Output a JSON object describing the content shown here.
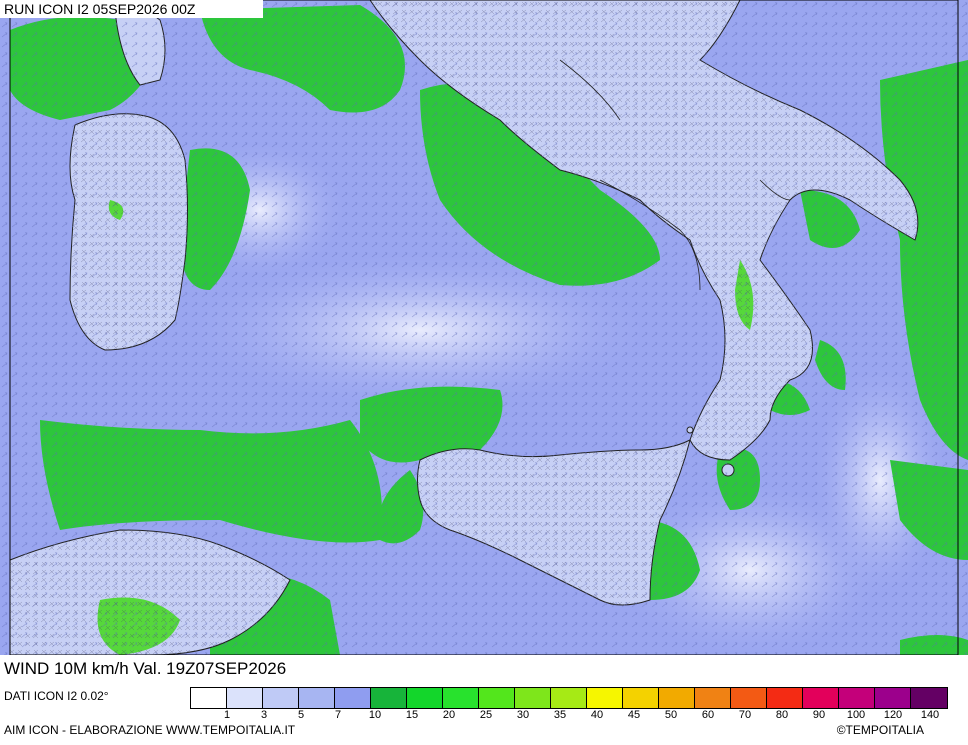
{
  "header": {
    "run": "RUN ICON I2 05SEP2026 00Z"
  },
  "panel": {
    "title": "WIND 10M km/h Val. 19Z07SEP2026"
  },
  "info": {
    "data_source": "DATI ICON I2 0.02°"
  },
  "footer": {
    "left": "AIM ICON - ELABORAZIONE WWW.TEMPOITALIA.IT",
    "right": "©TEMPOITALIA"
  },
  "legend": {
    "ticks": [
      "1",
      "3",
      "5",
      "7",
      "10",
      "15",
      "20",
      "25",
      "30",
      "35",
      "40",
      "45",
      "50",
      "60",
      "70",
      "80",
      "90",
      "100",
      "120",
      "140"
    ],
    "colors": [
      "#ffffff",
      "#dbe2fb",
      "#bfcaf6",
      "#a7b5f2",
      "#8f9df0",
      "#17b43a",
      "#13d62b",
      "#28e22d",
      "#53e61c",
      "#7ee61b",
      "#a6ea15",
      "#f6f600",
      "#f4d200",
      "#f2aa00",
      "#f08214",
      "#f35a14",
      "#f42b14",
      "#e3005b",
      "#c4007a",
      "#9c008c",
      "#640064"
    ]
  },
  "map": {
    "colors": {
      "sea_calm": "#9aa6f0",
      "sea_light": "#cdd4fb",
      "land": "#c7d0f5",
      "wind_green": "#2dc63c",
      "wind_green_light": "#56d83b",
      "coast": "#222222"
    }
  }
}
